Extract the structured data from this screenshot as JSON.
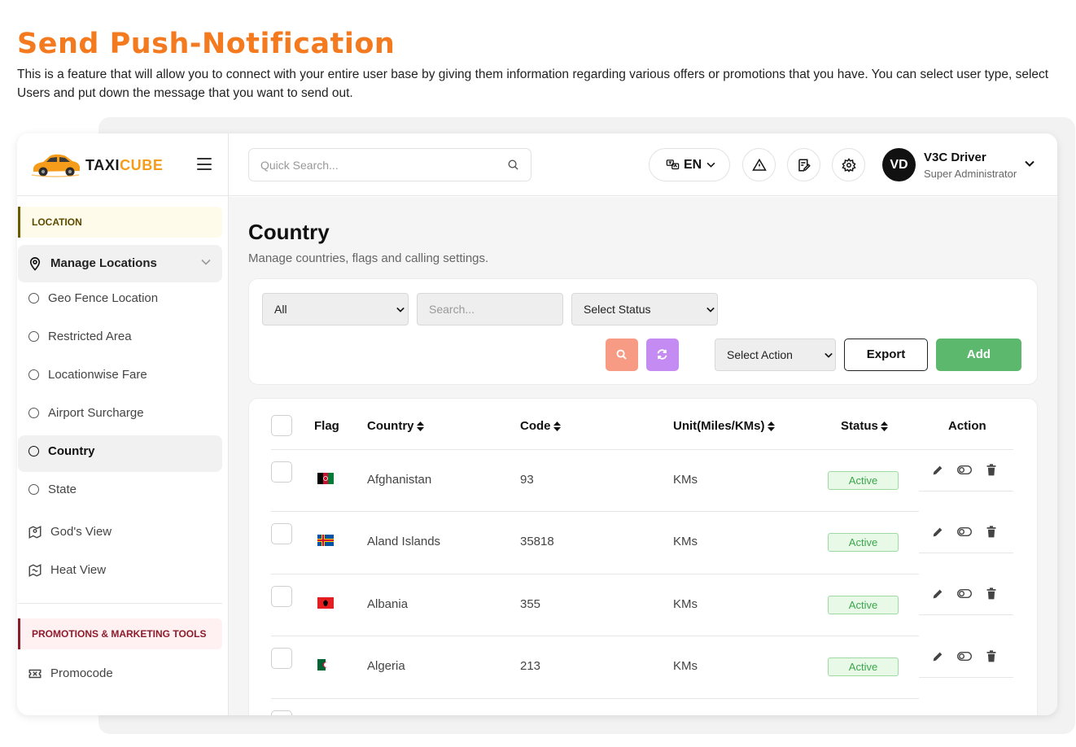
{
  "headline": "Send Push-Notification",
  "intro": "This is a feature that will allow you to connect with your entire user base by giving them information regarding various offers or promotions that you have. You can select user type, select Users and put down the message that you want to send out.",
  "brand": {
    "name_a": "TAXI",
    "name_b": "CUBE"
  },
  "sidebar": {
    "section_location": "LOCATION",
    "parent_label": "Manage Locations",
    "sub_items": [
      "Geo Fence Location",
      "Restricted Area",
      "Locationwise Fare",
      "Airport Surcharge",
      "Country",
      "State"
    ],
    "active_item": "Country",
    "nav_items": [
      {
        "label": "God's View",
        "icon": "map-pin-icon"
      },
      {
        "label": "Heat View",
        "icon": "heat-map-icon"
      }
    ],
    "section_promo": "PROMOTIONS & MARKETING TOOLS",
    "promo_items": [
      {
        "label": "Promocode",
        "icon": "ticket-icon"
      }
    ]
  },
  "topbar": {
    "search_placeholder": "Quick Search...",
    "language": "EN",
    "user_initials": "VD",
    "user_name": "V3C Driver",
    "user_role": "Super Administrator"
  },
  "page": {
    "title": "Country",
    "subtitle": "Manage countries, flags and calling settings."
  },
  "filters": {
    "type_selected": "All",
    "search_placeholder": "Search...",
    "status_selected": "Select Status",
    "action_selected": "Select Action",
    "export_label": "Export",
    "add_label": "Add"
  },
  "table": {
    "headers": {
      "flag": "Flag",
      "country": "Country",
      "code": "Code",
      "unit": "Unit(Miles/KMs)",
      "status": "Status",
      "action": "Action"
    },
    "rows": [
      {
        "flag": "af",
        "country": "Afghanistan",
        "code": "93",
        "unit": "KMs",
        "status": "Active"
      },
      {
        "flag": "ax",
        "country": "Aland Islands",
        "code": "35818",
        "unit": "KMs",
        "status": "Active"
      },
      {
        "flag": "al",
        "country": "Albania",
        "code": "355",
        "unit": "KMs",
        "status": "Active"
      },
      {
        "flag": "dz",
        "country": "Algeria",
        "code": "213",
        "unit": "KMs",
        "status": "Active"
      }
    ]
  },
  "colors": {
    "accent_orange": "#f47a1f",
    "brand_yellow": "#f59c1a",
    "add_green": "#5cb86d",
    "search_button": "#f79b84",
    "reset_button": "#c48cf2",
    "active_badge": "#3aa64a"
  }
}
